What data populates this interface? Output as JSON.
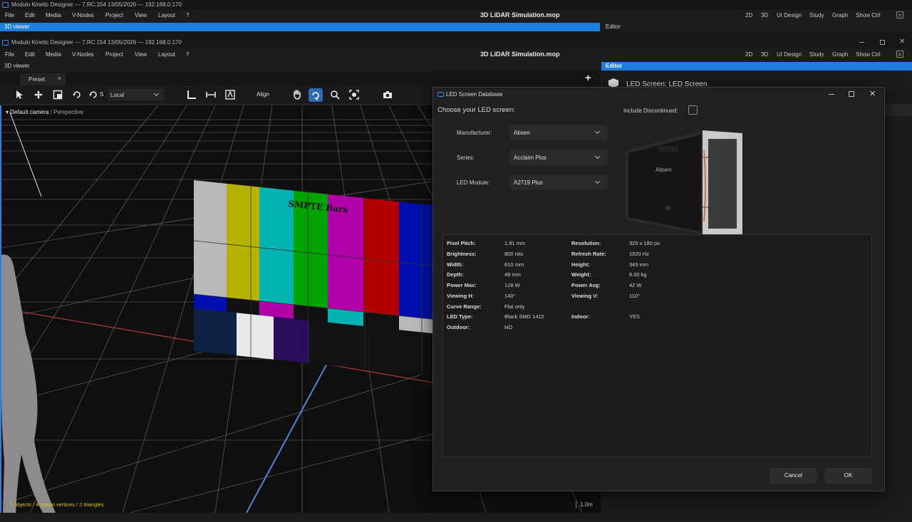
{
  "app": {
    "title": "Modulo Kinetic Designer --- 7.RC.154 13/05/2026 --- 192.168.0.170",
    "document_title": "3D LiDAR Simulation.mop"
  },
  "menu": [
    "File",
    "Edit",
    "Media",
    "V-Nodes",
    "Project",
    "View",
    "Layout",
    "?"
  ],
  "modes": [
    "2D",
    "3D",
    "UI Design",
    "Study",
    "Graph",
    "Show Ctrl"
  ],
  "panels": {
    "viewer_active": "3D viewer",
    "viewer": "3D viewer",
    "editor": "Editor",
    "editor_heading": "LED Screen: LED Screen"
  },
  "tabs": {
    "preset": "Preset",
    "add": "+"
  },
  "toolbar": {
    "snap_label": "S",
    "space_select": "Local",
    "align": "Align"
  },
  "viewport": {
    "camera": "Default camera",
    "projection": "Perspective",
    "separator": "|",
    "stats": "1 objects / 4 drawn vertices / 2 triangles",
    "scale": "1.0m",
    "screen_label": "SMPTE Bars"
  },
  "colors": {
    "accent": "#2f7fd8",
    "stats_text": "#e0c020"
  },
  "dialog": {
    "title": "LED Screen Database",
    "prompt": "Choose your LED screen:",
    "include_discontinued": "Include Discontinued:",
    "include_discontinued_checked": false,
    "fields": [
      {
        "label": "Manufacturer:",
        "value": "Absen"
      },
      {
        "label": "Series:",
        "value": "Acclaim Plus"
      },
      {
        "label": "LED Module:",
        "value": "A2719 Plus"
      }
    ],
    "brand_text": "Absen",
    "specs_left": [
      {
        "k": "Pixel Pitch:",
        "v": "1.91 mm"
      },
      {
        "k": "Brightness:",
        "v": "800 nits"
      },
      {
        "k": "Width:",
        "v": "610 mm"
      },
      {
        "k": "Depth:",
        "v": "49 mm"
      },
      {
        "k": "Power Max:",
        "v": "128 W"
      },
      {
        "k": "Viewing H:",
        "v": "140°"
      },
      {
        "k": "Curve Range:",
        "v": "Flat only"
      },
      {
        "k": "LED Type:",
        "v": "Black SMD 1415"
      },
      {
        "k": "Outdoor:",
        "v": "NO"
      }
    ],
    "specs_right": [
      {
        "k": "Resolution:",
        "v": "320 x 180 px"
      },
      {
        "k": "Refresh Rate:",
        "v": "1920 Hz"
      },
      {
        "k": "Height:",
        "v": "343 mm"
      },
      {
        "k": "Weight:",
        "v": "6.00 kg"
      },
      {
        "k": "Power Avg:",
        "v": "42 W"
      },
      {
        "k": "Viewing V:",
        "v": "110°"
      },
      {
        "k": "Indoor:",
        "v": "YES"
      }
    ],
    "cancel": "Cancel",
    "ok": "OK"
  }
}
